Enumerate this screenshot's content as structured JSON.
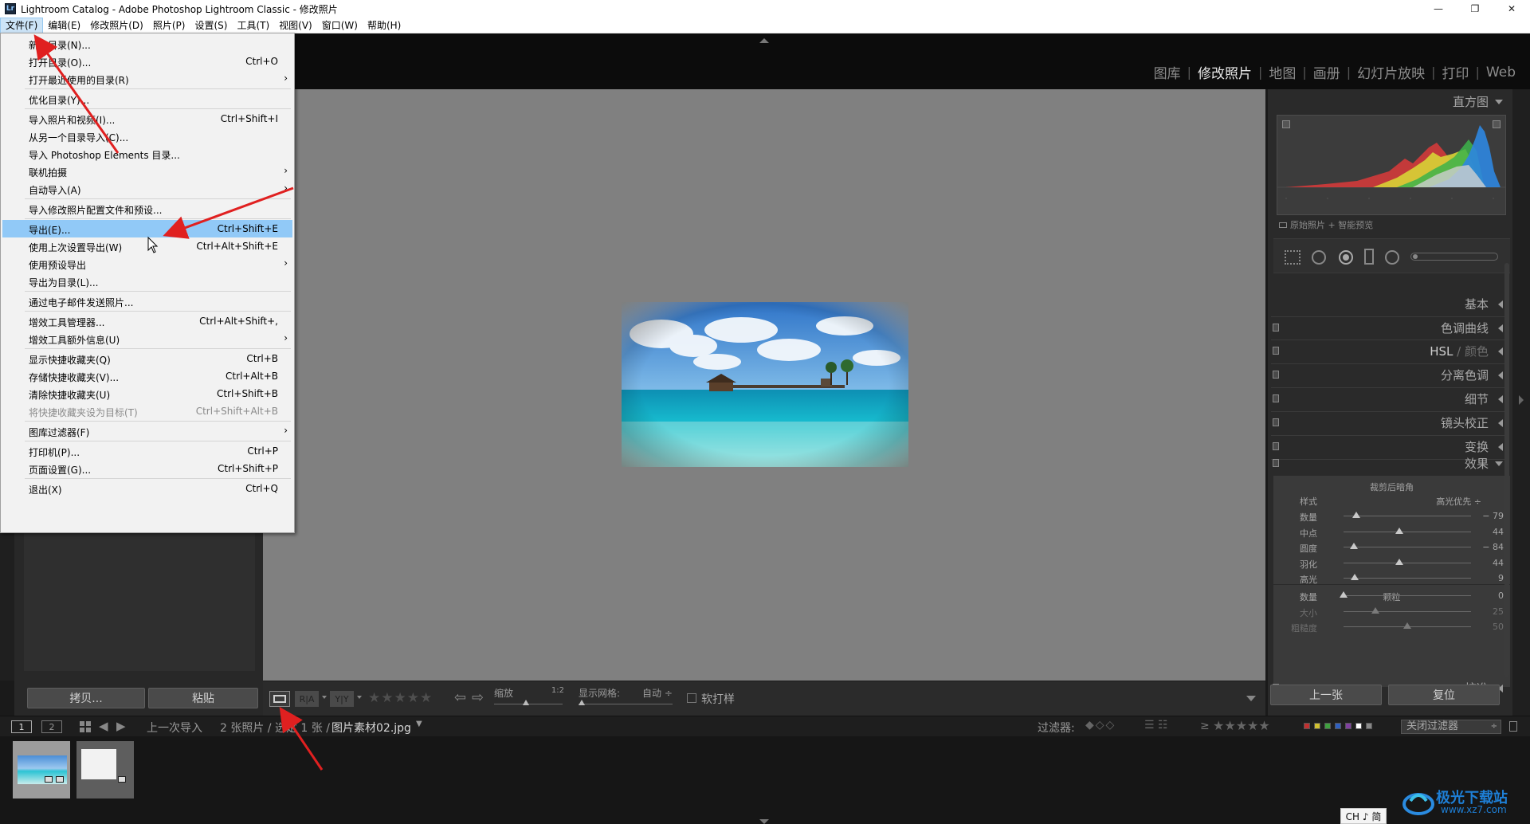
{
  "window": {
    "title": "Lightroom Catalog - Adobe Photoshop Lightroom Classic - 修改照片",
    "icon_text": "Lr",
    "controls": [
      "—",
      "❐",
      "✕"
    ]
  },
  "menubar": [
    "文件(F)",
    "编辑(E)",
    "修改照片(D)",
    "照片(P)",
    "设置(S)",
    "工具(T)",
    "视图(V)",
    "窗口(W)",
    "帮助(H)"
  ],
  "modules": [
    "图库",
    "修改照片",
    "地图",
    "画册",
    "幻灯片放映",
    "打印",
    "Web"
  ],
  "file_menu": {
    "items": [
      {
        "label": "新建目录(N)...",
        "shortcut": ""
      },
      {
        "label": "打开目录(O)...",
        "shortcut": "Ctrl+O"
      },
      {
        "label": "打开最近使用的目录(R)",
        "shortcut": "",
        "submenu": true
      },
      {
        "label": "优化目录(Y)...",
        "shortcut": ""
      },
      {
        "label": "导入照片和视频(I)...",
        "shortcut": "Ctrl+Shift+I"
      },
      {
        "label": "从另一个目录导入(C)...",
        "shortcut": ""
      },
      {
        "label": "导入 Photoshop Elements 目录...",
        "shortcut": ""
      },
      {
        "label": "联机拍摄",
        "shortcut": "",
        "submenu": true
      },
      {
        "label": "自动导入(A)",
        "shortcut": "",
        "submenu": true
      },
      {
        "label": "导入修改照片配置文件和预设...",
        "shortcut": ""
      },
      {
        "label": "导出(E)...",
        "shortcut": "Ctrl+Shift+E",
        "highlighted": true
      },
      {
        "label": "使用上次设置导出(W)",
        "shortcut": "Ctrl+Alt+Shift+E"
      },
      {
        "label": "使用预设导出",
        "shortcut": "",
        "submenu": true
      },
      {
        "label": "导出为目录(L)...",
        "shortcut": ""
      },
      {
        "label": "通过电子邮件发送照片...",
        "shortcut": ""
      },
      {
        "label": "增效工具管理器...",
        "shortcut": "Ctrl+Alt+Shift+,"
      },
      {
        "label": "增效工具额外信息(U)",
        "shortcut": "",
        "submenu": true
      },
      {
        "label": "显示快捷收藏夹(Q)",
        "shortcut": "Ctrl+B"
      },
      {
        "label": "存储快捷收藏夹(V)...",
        "shortcut": "Ctrl+Alt+B"
      },
      {
        "label": "清除快捷收藏夹(U)",
        "shortcut": "Ctrl+Shift+B"
      },
      {
        "label": "将快捷收藏夹设为目标(T)",
        "shortcut": "Ctrl+Shift+Alt+B",
        "disabled": true
      },
      {
        "label": "图库过滤器(F)",
        "shortcut": "",
        "submenu": true
      },
      {
        "label": "打印机(P)...",
        "shortcut": "Ctrl+P"
      },
      {
        "label": "页面设置(G)...",
        "shortcut": "Ctrl+Shift+P"
      },
      {
        "label": "退出(X)",
        "shortcut": "Ctrl+Q"
      }
    ]
  },
  "left_panel": {
    "copy_label": "拷贝...",
    "paste_label": "粘贴"
  },
  "toolbar": {
    "zoom_label": "缩放",
    "zoom_value": "1:2",
    "grid_label": "显示网格:",
    "grid_value": "自动 ÷",
    "soft_proof_label": "软打样",
    "view_buttons": [
      "R|A",
      "Y|Y"
    ]
  },
  "right_panel": {
    "histogram_title": "直方图",
    "histogram_note": "原始照片 + 智能预览",
    "sections": [
      "基本",
      "色调曲线",
      "HSL / 颜色",
      "分离色调",
      "细节",
      "镜头校正",
      "变换",
      "效果",
      "校准"
    ],
    "hsl_main": "HSL",
    "hsl_sep": "/",
    "hsl_color": "颜色",
    "vignette": {
      "title": "裁剪后暗角",
      "style_label": "样式",
      "style_value": "高光优先 ÷",
      "sliders": [
        {
          "label": "数量",
          "value": "− 79",
          "fraction": 0.1
        },
        {
          "label": "中点",
          "value": "44",
          "fraction": 0.44
        },
        {
          "label": "圆度",
          "value": "− 84",
          "fraction": 0.08
        },
        {
          "label": "羽化",
          "value": "44",
          "fraction": 0.44
        },
        {
          "label": "高光",
          "value": "9",
          "fraction": 0.09
        }
      ]
    },
    "grain": {
      "title": "颗粒",
      "sliders": [
        {
          "label": "数量",
          "value": "0",
          "fraction": 0.0,
          "dim": false
        },
        {
          "label": "大小",
          "value": "25",
          "fraction": 0.25,
          "dim": true
        },
        {
          "label": "粗糙度",
          "value": "50",
          "fraction": 0.5,
          "dim": true
        }
      ]
    },
    "prev_label": "上一张",
    "reset_label": "复位"
  },
  "filmstrip": {
    "pages": [
      "1",
      "2"
    ],
    "source": "上一次导入",
    "count": "2 张照片 / 选定 1 张 /",
    "filename": "图片素材02.jpg",
    "filter_label": "过滤器:",
    "filter_off": "关闭过滤器",
    "rating_op": "≥",
    "label_colors": [
      "#c03030",
      "#d0c030",
      "#40a040",
      "#3060c0",
      "#8040a0",
      "#ffffff",
      "#888888"
    ]
  },
  "ime": "CH ♪ 简",
  "watermark": {
    "line1": "极光下载站",
    "line2": "www.xz7.com"
  },
  "colors": {
    "menu_highlight": "#91c9f7",
    "arrow_red": "#e02020",
    "panel_bg": "#2a2a2a",
    "canvas_bg": "#808080"
  }
}
